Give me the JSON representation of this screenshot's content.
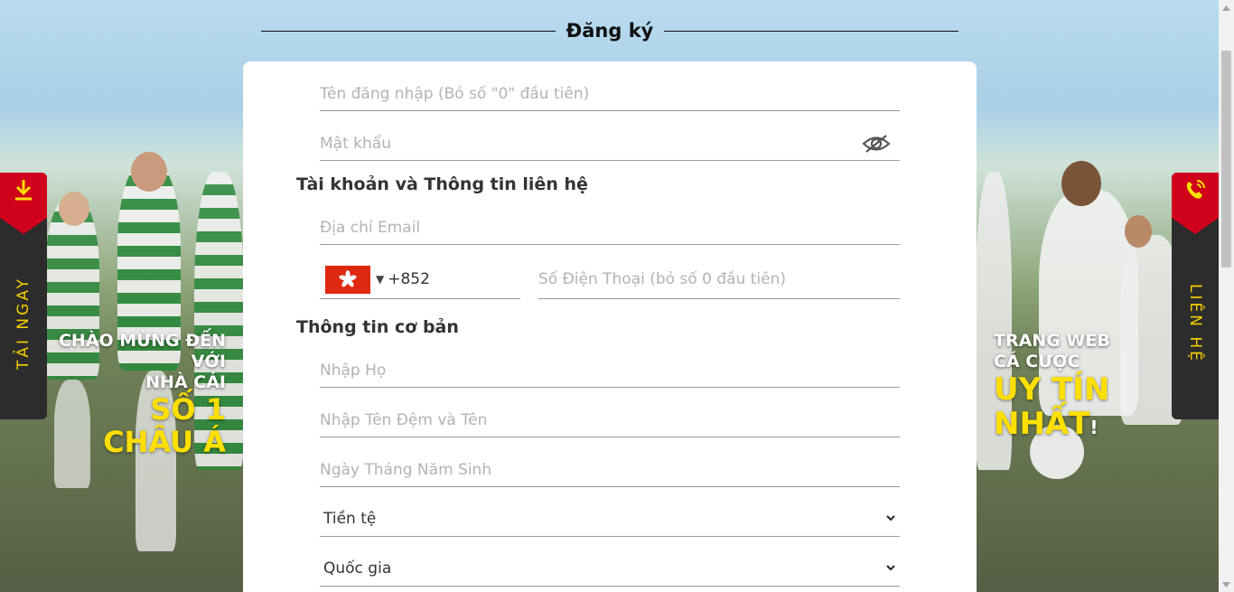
{
  "page": {
    "title": "Đăng ký"
  },
  "form": {
    "username_placeholder": "Tên đăng nhập (Bỏ số \"0\" đầu tiên)",
    "password_placeholder": "Mật khẩu",
    "section_contact": "Tài khoản và Thông tin liên hệ",
    "email_placeholder": "Địa chỉ Email",
    "phone_country_code": "+852",
    "phone_flag": "hong-kong-flag",
    "phone_placeholder": "Số Điện Thoại (bỏ số 0 đầu tiên)",
    "section_basic": "Thông tin cơ bản",
    "lastname_placeholder": "Nhập Họ",
    "firstname_placeholder": "Nhập Tên Đệm và Tên",
    "dob_placeholder": "Ngày Tháng Năm Sinh",
    "currency_label": "Tiền tệ",
    "country_label": "Quốc gia"
  },
  "side_tabs": {
    "left_label": "TẢI NGAY",
    "left_icon": "download-icon",
    "right_label": "LIÊN HỆ",
    "right_icon": "phone-icon"
  },
  "promo_left": {
    "line1": "CHÀO MỪNG ĐẾN",
    "line2": "VỚI",
    "line3": "NHÀ CÁI",
    "line4": "SỐ 1",
    "line5": "CHÂU Á"
  },
  "promo_right": {
    "line1": "TRANG WEB",
    "line2": "CÁ CƯỢC",
    "line3": "UY TÍN",
    "line4": "NHẤT",
    "line5": "!"
  },
  "colors": {
    "accent_red": "#d0021b",
    "accent_yellow": "#ffdf00",
    "tab_dark": "#2c2c2c"
  }
}
